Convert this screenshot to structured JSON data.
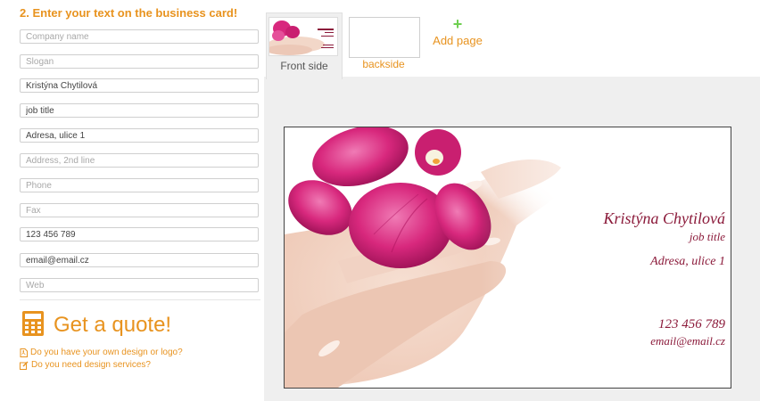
{
  "form": {
    "title": "2. Enter your text on the business card!",
    "fields": [
      {
        "placeholder": "Company name",
        "value": ""
      },
      {
        "placeholder": "Slogan",
        "value": ""
      },
      {
        "placeholder": "",
        "value": "Kristýna Chytilová"
      },
      {
        "placeholder": "",
        "value": "job title"
      },
      {
        "placeholder": "",
        "value": "Adresa, ulice 1"
      },
      {
        "placeholder": "Address, 2nd line",
        "value": ""
      },
      {
        "placeholder": "Phone",
        "value": ""
      },
      {
        "placeholder": "Fax",
        "value": ""
      },
      {
        "placeholder": "",
        "value": "123 456 789"
      },
      {
        "placeholder": "",
        "value": "email@email.cz"
      },
      {
        "placeholder": "Web",
        "value": ""
      }
    ],
    "quote_label": "Get a quote!",
    "link_design": "Do you have your own design or logo?",
    "link_services": "Do you need design services?"
  },
  "tabs": {
    "front": "Front side",
    "back": "backside",
    "add_page": "Add page",
    "add_icon": "+"
  },
  "card": {
    "name": "Kristýna Chytilová",
    "job_title": "job title",
    "address": "Adresa, ulice 1",
    "phone": "123 456 789",
    "email": "email@email.cz"
  },
  "colors": {
    "accent": "#e8931f",
    "add_green": "#6ecf51",
    "card_text": "#8b1a3a",
    "orchid": "#d8287d"
  },
  "icons": {
    "quote": "calculator-icon",
    "design": "file-pdf-icon",
    "services": "edit-icon"
  }
}
